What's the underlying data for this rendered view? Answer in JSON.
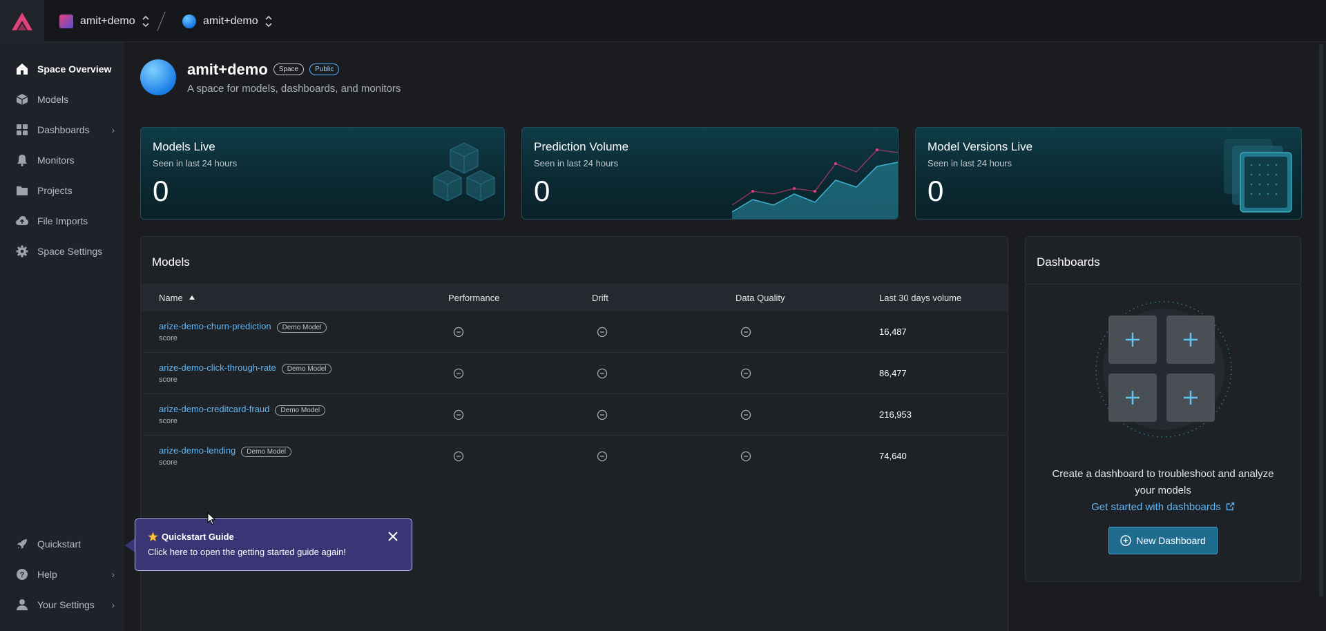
{
  "colors": {
    "accent": "#63b6f2",
    "brand": "#e2417a",
    "tooltip": "#3a3675"
  },
  "topbar": {
    "org_name": "amit+demo",
    "space_name": "amit+demo"
  },
  "sidebar": {
    "items": [
      {
        "label": "Space Overview",
        "icon": "home-icon"
      },
      {
        "label": "Models",
        "icon": "cube-icon"
      },
      {
        "label": "Dashboards",
        "icon": "grid-icon"
      },
      {
        "label": "Monitors",
        "icon": "bell-icon"
      },
      {
        "label": "Projects",
        "icon": "folder-icon"
      },
      {
        "label": "File Imports",
        "icon": "cloud-upload-icon"
      },
      {
        "label": "Space Settings",
        "icon": "gear-icon"
      }
    ],
    "bottom": [
      {
        "label": "Quickstart",
        "icon": "rocket-icon"
      },
      {
        "label": "Help",
        "icon": "help-icon"
      },
      {
        "label": "Your Settings",
        "icon": "user-icon"
      }
    ]
  },
  "space": {
    "title": "amit+demo",
    "badge_space": "Space",
    "badge_public": "Public",
    "description": "A space for models, dashboards, and monitors"
  },
  "stats": [
    {
      "title": "Models Live",
      "subtitle": "Seen in last 24 hours",
      "value": "0"
    },
    {
      "title": "Prediction Volume",
      "subtitle": "Seen in last 24 hours",
      "value": "0"
    },
    {
      "title": "Model Versions Live",
      "subtitle": "Seen in last 24 hours",
      "value": "0"
    }
  ],
  "models_panel": {
    "title": "Models",
    "columns": [
      "Name",
      "Performance",
      "Drift",
      "Data Quality",
      "Last 30 days volume"
    ],
    "rows": [
      {
        "name": "arize-demo-churn-prediction",
        "badge": "Demo Model",
        "type": "score",
        "volume": "16,487"
      },
      {
        "name": "arize-demo-click-through-rate",
        "badge": "Demo Model",
        "type": "score",
        "volume": "86,477"
      },
      {
        "name": "arize-demo-creditcard-fraud",
        "badge": "Demo Model",
        "type": "score",
        "volume": "216,953"
      },
      {
        "name": "arize-demo-lending",
        "badge": "Demo Model",
        "type": "score",
        "volume": "74,640"
      }
    ]
  },
  "dashboards_panel": {
    "title": "Dashboards",
    "empty_line1": "Create a dashboard to troubleshoot and analyze",
    "empty_line2": "your models",
    "link": "Get started with dashboards",
    "button": "New Dashboard"
  },
  "quickstart_tip": {
    "title": "Quickstart Guide",
    "body": "Click here to open the getting started guide again!"
  }
}
